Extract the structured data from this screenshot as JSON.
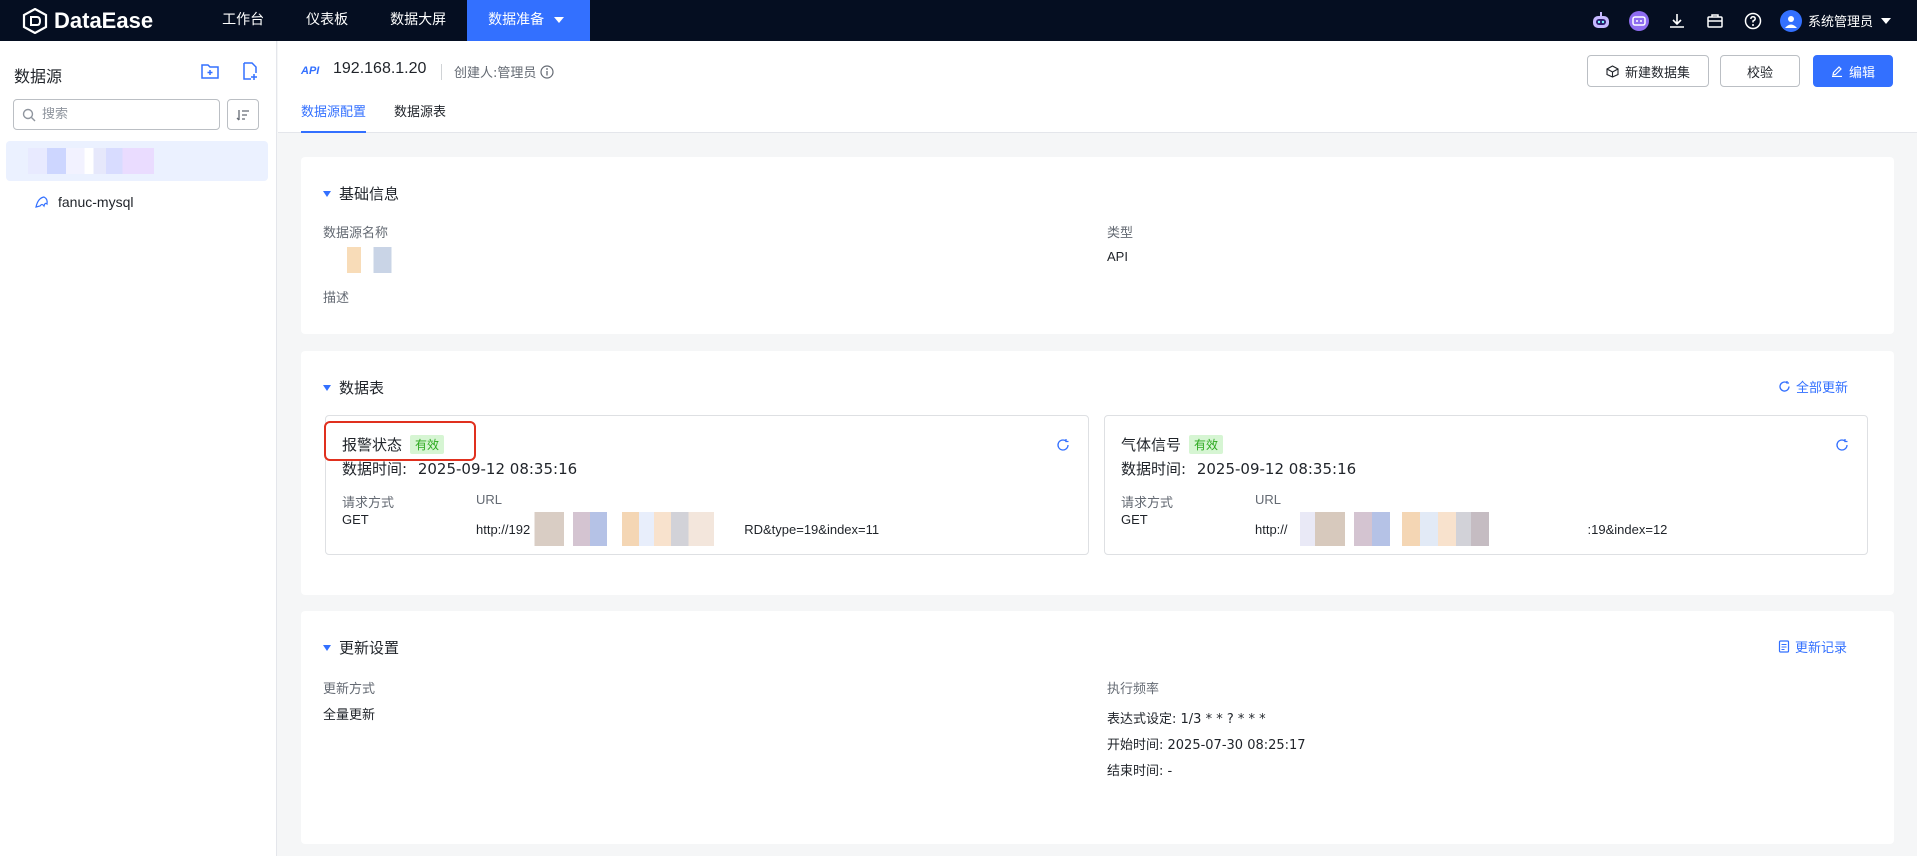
{
  "app": {
    "name": "DataEase"
  },
  "nav": {
    "items": [
      "工作台",
      "仪表板",
      "数据大屏",
      "数据准备"
    ],
    "active_index": 3
  },
  "user": {
    "name": "系统管理员"
  },
  "sidebar": {
    "title": "数据源",
    "search_placeholder": "搜索",
    "items": [
      {
        "label": ""
      },
      {
        "label": "fanuc-mysql"
      }
    ]
  },
  "header": {
    "api_tag": "API",
    "ds_name": "192.168.1.20",
    "creator": "创建人:管理员",
    "tabs": [
      "数据源配置",
      "数据源表"
    ],
    "buttons": {
      "new_dataset": "新建数据集",
      "validate": "校验",
      "edit": "编辑"
    }
  },
  "basic": {
    "title": "基础信息",
    "name_label": "数据源名称",
    "type_label": "类型",
    "type_value": "API",
    "desc_label": "描述"
  },
  "tables": {
    "title": "数据表",
    "refresh_all": "全部更新",
    "items": [
      {
        "name": "报警状态",
        "status": "有效",
        "time_label": "数据时间:",
        "time": "2025-09-12 08:35:16",
        "method_label": "请求方式",
        "method": "GET",
        "url_label": "URL",
        "url_prefix": "http://192",
        "url_suffix": "RD&type=19&index=11"
      },
      {
        "name": "气体信号",
        "status": "有效",
        "time_label": "数据时间:",
        "time": "2025-09-12 08:35:16",
        "method_label": "请求方式",
        "method": "GET",
        "url_label": "URL",
        "url_prefix": "http://",
        "url_suffix": ":19&index=12"
      }
    ]
  },
  "update": {
    "title": "更新设置",
    "record": "更新记录",
    "mode_label": "更新方式",
    "mode_value": "全量更新",
    "freq_label": "执行频率",
    "cron": "表达式设定: 1/3 * * ? * * *",
    "start": "开始时间: 2025-07-30 08:25:17",
    "end": "结束时间: -"
  },
  "colors": {
    "primary": "#3370ff",
    "topbar": "#050e21",
    "valid_green": "#2ca91f",
    "highlight_red": "#e0301e"
  }
}
